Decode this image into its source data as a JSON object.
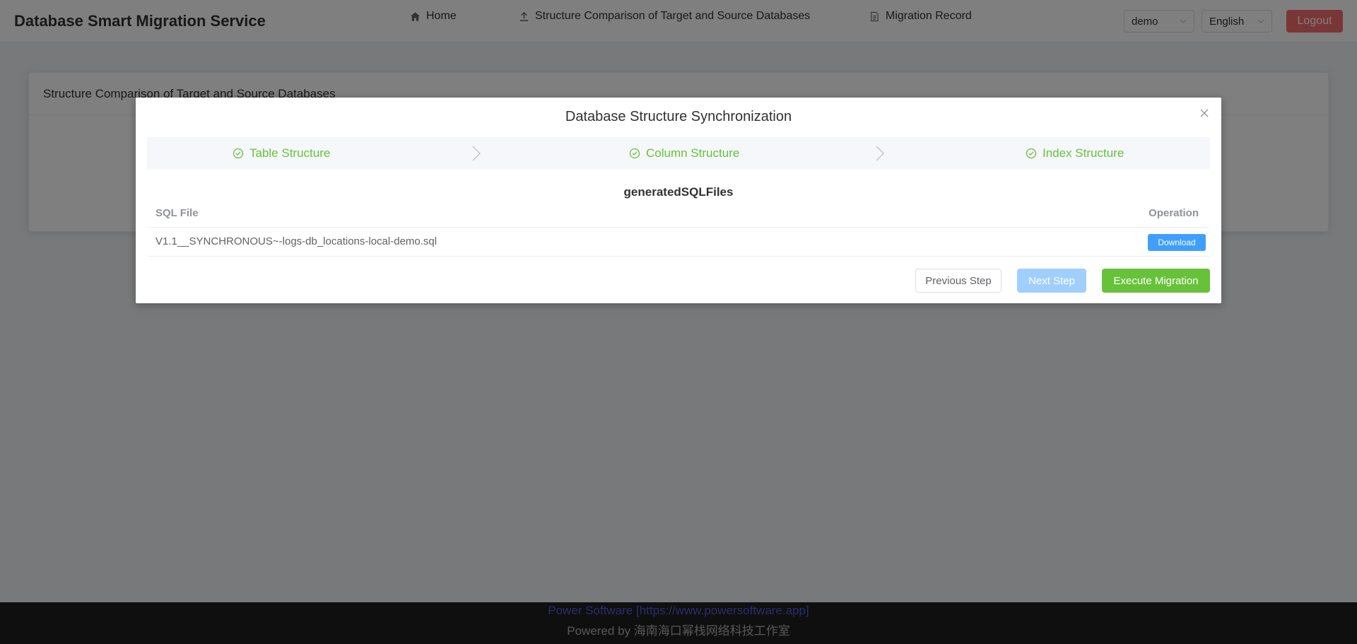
{
  "header": {
    "app_title": "Database Smart Migration Service",
    "nav": [
      {
        "label": "Home",
        "icon": "home-icon"
      },
      {
        "label": "Structure Comparison of Target and Source Databases",
        "icon": "upload-icon"
      },
      {
        "label": "Migration Record",
        "icon": "document-icon"
      }
    ],
    "user_select": "demo",
    "language_select": "English",
    "logout_label": "Logout"
  },
  "card": {
    "title": "Structure Comparison of Target and Source Databases"
  },
  "dialog": {
    "title": "Database Structure Synchronization",
    "steps": [
      {
        "label": "Table Structure",
        "status": "success"
      },
      {
        "label": "Column Structure",
        "status": "success"
      },
      {
        "label": "Index Structure",
        "status": "success"
      }
    ],
    "section_title": "generatedSQLFiles",
    "table": {
      "columns": [
        "SQL File",
        "Operation"
      ],
      "rows": [
        {
          "file": "V1.1__SYNCHRONOUS~-logs-db_locations-local-demo.sql",
          "action": "Download"
        }
      ]
    },
    "buttons": {
      "previous": "Previous Step",
      "next": "Next Step",
      "execute": "Execute Migration"
    }
  },
  "footer": {
    "link_text": "Power Software [https://www.powersoftware.app]",
    "powered_by": "Powered by 海南海口幂栈网络科技工作室"
  },
  "colors": {
    "success": "#67c23a",
    "primary": "#409eff",
    "danger": "#f56c6c",
    "footer_bg": "#1f1f1f"
  }
}
